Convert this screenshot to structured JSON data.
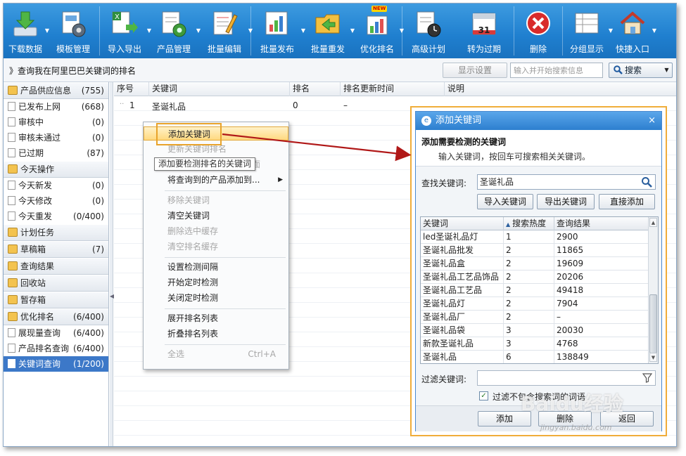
{
  "toolbar": {
    "buttons": [
      {
        "label": "下载数据",
        "icon": "download-icon",
        "dropdown": true
      },
      {
        "label": "模板管理",
        "icon": "template-gear-icon",
        "dropdown": false
      },
      {
        "label": "导入导出",
        "icon": "excel-import-icon",
        "dropdown": true
      },
      {
        "label": "产品管理",
        "icon": "product-gear-icon",
        "dropdown": true
      },
      {
        "label": "批量编辑",
        "icon": "edit-list-icon",
        "dropdown": true
      },
      {
        "label": "批量发布",
        "icon": "publish-chart-icon",
        "dropdown": true
      },
      {
        "label": "批量重发",
        "icon": "republish-folder-icon",
        "dropdown": true
      },
      {
        "label": "优化排名",
        "icon": "ranking-chart-icon",
        "dropdown": true,
        "badge": "NEW"
      },
      {
        "label": "高级计划",
        "icon": "schedule-clock-icon",
        "dropdown": false
      },
      {
        "label": "转为过期",
        "icon": "calendar-31-icon",
        "dropdown": false,
        "icon_text": "31"
      },
      {
        "label": "删除",
        "icon": "delete-x-icon",
        "dropdown": false
      },
      {
        "label": "分组显示",
        "icon": "group-list-icon",
        "dropdown": true
      },
      {
        "label": "快捷入口",
        "icon": "home-icon",
        "dropdown": true
      }
    ]
  },
  "querybar": {
    "title": "》查询我在阿里巴巴关键词的排名",
    "display_settings": "显示设置",
    "search_placeholder": "输入并开始搜索信息",
    "search_label": "搜索"
  },
  "sidebar": {
    "groups": [
      {
        "label": "产品供应信息",
        "count": "(755)",
        "items": [
          {
            "label": "已发布上网",
            "count": "(668)"
          },
          {
            "label": "审核中",
            "count": "(0)"
          },
          {
            "label": "审核未通过",
            "count": "(0)"
          },
          {
            "label": "已过期",
            "count": "(87)"
          }
        ]
      },
      {
        "label": "今天操作",
        "count": "",
        "items": [
          {
            "label": "今天新发",
            "count": "(0)"
          },
          {
            "label": "今天修改",
            "count": "(0)"
          },
          {
            "label": "今天重发",
            "count": "(0/400)"
          }
        ]
      },
      {
        "label": "计划任务",
        "count": "",
        "items": []
      },
      {
        "label": "草稿箱",
        "count": "(7)",
        "items": []
      },
      {
        "label": "查询结果",
        "count": "",
        "items": []
      },
      {
        "label": "回收站",
        "count": "",
        "items": []
      },
      {
        "label": "暂存箱",
        "count": "",
        "items": []
      },
      {
        "label": "优化排名",
        "count": "(6/400)",
        "items": [
          {
            "label": "展现量查询",
            "count": "(6/400)"
          },
          {
            "label": "产品排名查询",
            "count": "(6/400)"
          },
          {
            "label": "关键词查询",
            "count": "(1/200)",
            "active": true
          }
        ]
      }
    ]
  },
  "table": {
    "headers": [
      "序号",
      "关键词",
      "排名",
      "排名更新时间",
      "说明"
    ],
    "rows": [
      {
        "index": "1",
        "keyword": "圣诞礼品",
        "rank": "0",
        "updated": "–",
        "note": ""
      }
    ]
  },
  "context_menu": {
    "items": [
      {
        "label": "添加关键词",
        "disabled": false,
        "highlighted": true
      },
      {
        "label": "更新关键词排名",
        "disabled": true
      },
      {
        "label": "打开关键词排名所在页面",
        "disabled": true
      },
      {
        "label": "将查询到的产品添加到...",
        "disabled": false,
        "submenu": true
      },
      {
        "sep": true
      },
      {
        "label": "移除关键词",
        "disabled": true
      },
      {
        "label": "清空关键词",
        "disabled": false
      },
      {
        "label": "删除选中缓存",
        "disabled": true
      },
      {
        "label": "清空排名缓存",
        "disabled": true
      },
      {
        "sep": true
      },
      {
        "label": "设置检测间隔",
        "disabled": false
      },
      {
        "label": "开始定时检测",
        "disabled": false
      },
      {
        "label": "关闭定时检测",
        "disabled": false
      },
      {
        "sep": true
      },
      {
        "label": "展开排名列表",
        "disabled": false
      },
      {
        "label": "折叠排名列表",
        "disabled": false
      },
      {
        "sep": true
      },
      {
        "label": "全选",
        "disabled": true,
        "shortcut": "Ctrl+A"
      }
    ],
    "tooltip": "添加要检测排名的关键词"
  },
  "dialog": {
    "title": "添加关键词",
    "close": "×",
    "heading": "添加需要检测的关键词",
    "subheading": "输入关键词，按回车可搜索相关关键词。",
    "find_label": "查找关键词:",
    "find_value": "圣诞礼品",
    "buttons": {
      "import": "导入关键词",
      "export": "导出关键词",
      "direct_add": "直接添加"
    },
    "grid": {
      "headers": [
        "关键词",
        "搜索热度",
        "查询结果"
      ],
      "rows": [
        [
          "led圣诞礼品灯",
          "1",
          "2900"
        ],
        [
          "圣诞礼品批发",
          "2",
          "11865"
        ],
        [
          "圣诞礼品盒",
          "2",
          "19609"
        ],
        [
          "圣诞礼品工艺品饰品",
          "2",
          "20206"
        ],
        [
          "圣诞礼品工艺品",
          "2",
          "49418"
        ],
        [
          "圣诞礼品灯",
          "2",
          "7904"
        ],
        [
          "圣诞礼品厂",
          "2",
          "–"
        ],
        [
          "圣诞礼品袋",
          "3",
          "20030"
        ],
        [
          "新款圣诞礼品",
          "3",
          "4768"
        ],
        [
          "圣诞礼品",
          "6",
          "138849"
        ]
      ]
    },
    "filter_label": "过滤关键词:",
    "filter_checkbox_label": "过滤不包含搜索词的词语",
    "footer": {
      "add": "添加",
      "delete": "删除",
      "back": "返回"
    }
  },
  "watermark": {
    "text": "Baidu经验",
    "sub": "jingyan.baidu.com"
  },
  "colors": {
    "toolbar": "#1f7fcf",
    "accent_frame": "#f0ad3a",
    "arrow": "#b01818",
    "selection": "#3c78c8"
  }
}
